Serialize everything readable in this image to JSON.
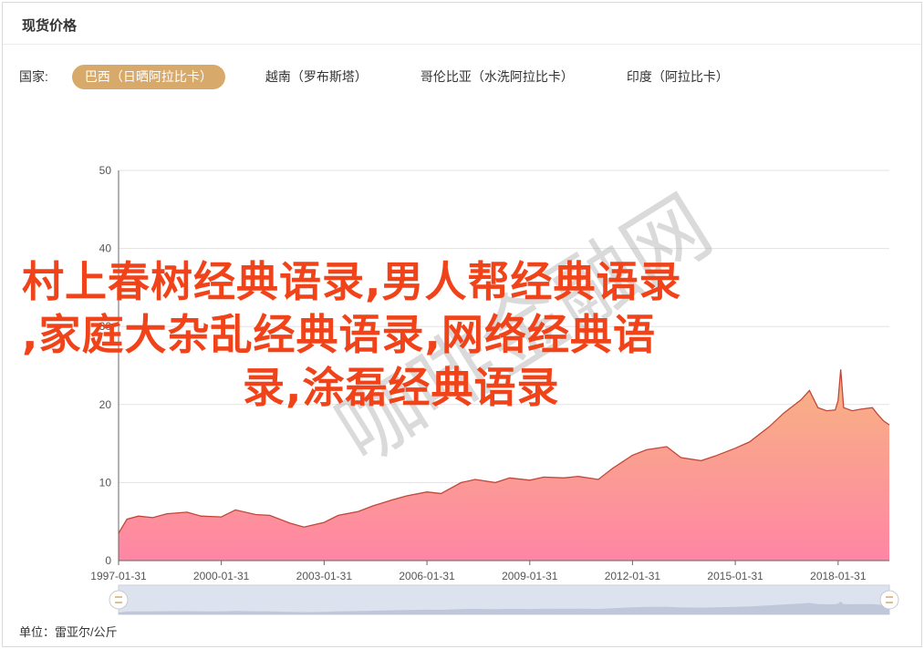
{
  "header": {
    "title": "现货价格"
  },
  "country_selector": {
    "label": "国家:",
    "tabs": [
      {
        "label": "巴西（日晒阿拉比卡）",
        "active": true
      },
      {
        "label": "越南（罗布斯塔）",
        "active": false
      },
      {
        "label": "哥伦比亚（水洗阿拉比卡）",
        "active": false
      },
      {
        "label": "印度（阿拉比卡）",
        "active": false
      }
    ]
  },
  "unit_label": "单位：雷亚尔/公斤",
  "overlay_text": {
    "line1": "村上春树经典语录,男人帮经典语录",
    "line2": ",家庭大杂乱经典语录,网络经典语",
    "line3": "录,涂磊经典语录"
  },
  "watermark": "咖啡金融网",
  "colors": {
    "area_top": "#f7b07a",
    "area_bottom": "#ff7fa0",
    "line": "#c2473a",
    "active_tab": "#d7a96b",
    "overlay_text": "#f1431a"
  },
  "chart_data": {
    "type": "area",
    "title": "",
    "xlabel": "",
    "ylabel": "",
    "ylim": [
      0,
      50
    ],
    "y_ticks": [
      0,
      10,
      20,
      30,
      40,
      50
    ],
    "x_tick_labels": [
      "1997-01-31",
      "2000-01-31",
      "2003-01-31",
      "2006-01-31",
      "2009-01-31",
      "2012-01-31",
      "2015-01-31",
      "2018-01-31"
    ],
    "grid": true,
    "x_range": [
      "1997-01-31",
      "2019-07-31"
    ],
    "series": [
      {
        "x": [
          "1997-01-31",
          "1997-04-30",
          "1997-08-31",
          "1998-01-31",
          "1998-06-30",
          "1999-01-31",
          "1999-06-30",
          "2000-01-31",
          "2000-06-30",
          "2001-01-31",
          "2001-06-30",
          "2002-01-31",
          "2002-06-30",
          "2003-01-31",
          "2003-06-30",
          "2004-01-31",
          "2004-06-30",
          "2005-01-31",
          "2005-06-30",
          "2006-01-31",
          "2006-06-30",
          "2007-01-31",
          "2007-06-30",
          "2008-01-31",
          "2008-06-30",
          "2009-01-31",
          "2009-06-30",
          "2010-01-31",
          "2010-06-30",
          "2011-01-31",
          "2011-06-30",
          "2012-01-31",
          "2012-06-30",
          "2013-01-31",
          "2013-06-30",
          "2014-01-31",
          "2014-06-30",
          "2015-01-31",
          "2015-06-30",
          "2016-01-31",
          "2016-06-30",
          "2016-12-31",
          "2017-03-31",
          "2017-06-30",
          "2017-09-30",
          "2017-12-31",
          "2018-01-31",
          "2018-02-28",
          "2018-03-31",
          "2018-06-30",
          "2018-09-30",
          "2019-01-31",
          "2019-03-31",
          "2019-05-31",
          "2019-07-31"
        ],
        "values": [
          3.5,
          5.3,
          5.7,
          5.5,
          6.0,
          6.2,
          5.7,
          5.6,
          6.5,
          5.9,
          5.8,
          4.8,
          4.3,
          4.9,
          5.8,
          6.3,
          7.0,
          7.8,
          8.3,
          8.8,
          8.6,
          10.0,
          10.4,
          10.0,
          10.6,
          10.3,
          10.7,
          10.6,
          10.8,
          10.4,
          11.8,
          13.5,
          14.2,
          14.6,
          13.2,
          12.8,
          13.4,
          14.4,
          15.2,
          17.2,
          18.9,
          20.6,
          21.8,
          19.6,
          19.2,
          19.3,
          20.5,
          24.5,
          19.6,
          19.2,
          19.4,
          19.6,
          18.7,
          17.9,
          17.4
        ]
      }
    ]
  }
}
